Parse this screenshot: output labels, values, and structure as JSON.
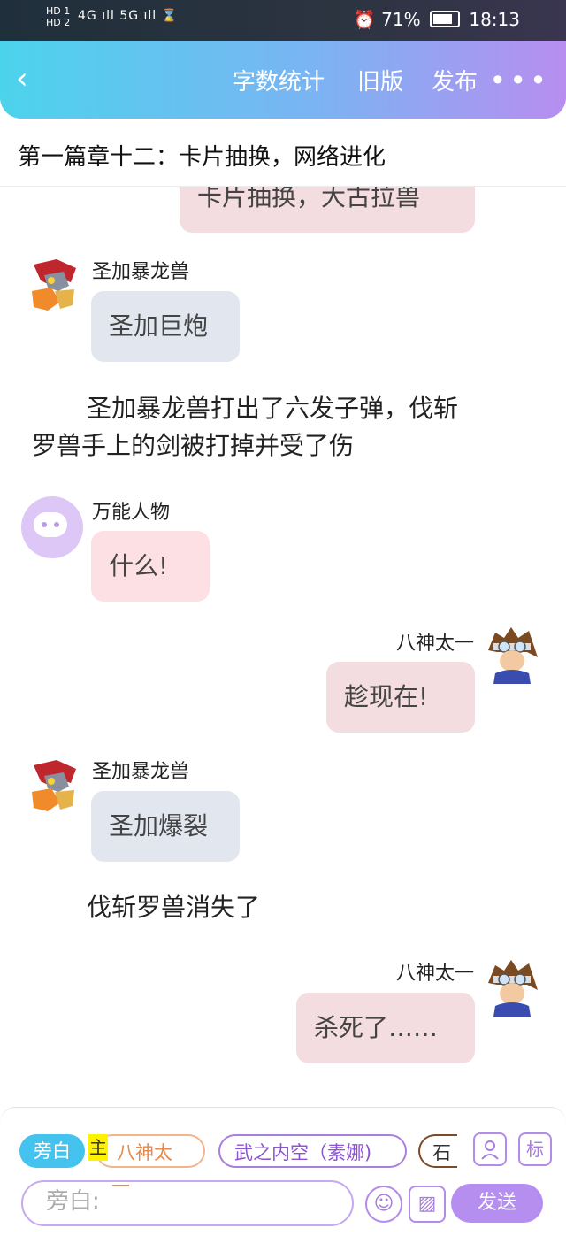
{
  "status_bar": {
    "left_top": "HD 1",
    "left_bottom": "HD 2",
    "signal": "4G ıll 5G ıll ⌛",
    "right": "⏰ 71%",
    "time": "18:13"
  },
  "header": {
    "back": "‹",
    "word_count": "字数统计",
    "old_version": "旧版",
    "publish": "发布",
    "more": "•••"
  },
  "chapter_title": "第一篇章十二：卡片抽换，网络进化",
  "messages": {
    "m0": "卡片抽换，大古拉兽",
    "m1_name": "圣加暴龙兽",
    "m1_text": "圣加巨炮",
    "n1_line1": "圣加暴龙兽打出了六发子弹，伐斩",
    "n1_line2": "罗兽手上的剑被打掉并受了伤",
    "m2_name": "万能人物",
    "m2_text": "什么!",
    "m3_name": "八神太一",
    "m3_text": "趁现在!",
    "m4_name": "圣加暴龙兽",
    "m4_text": "圣加爆裂",
    "n2": "伐斩罗兽消失了",
    "m5_name": "八神太一",
    "m5_text": "杀死了……"
  },
  "composer": {
    "role_active": "旁白",
    "main_mark": "主",
    "role_2": "八神太一",
    "role_3": "武之内空（素娜)",
    "role_4": "石",
    "icon_person": "person-card-icon",
    "icon_tag_label": "标",
    "input_placeholder": "旁白:",
    "emoji_icon": "☺",
    "image_icon": "▨",
    "send": "发送"
  },
  "colors": {
    "header_start": "#4cd3ec",
    "header_end": "#b78ef0",
    "accent_purple": "#b58ef0",
    "narration_chip": "#45c3ef"
  }
}
